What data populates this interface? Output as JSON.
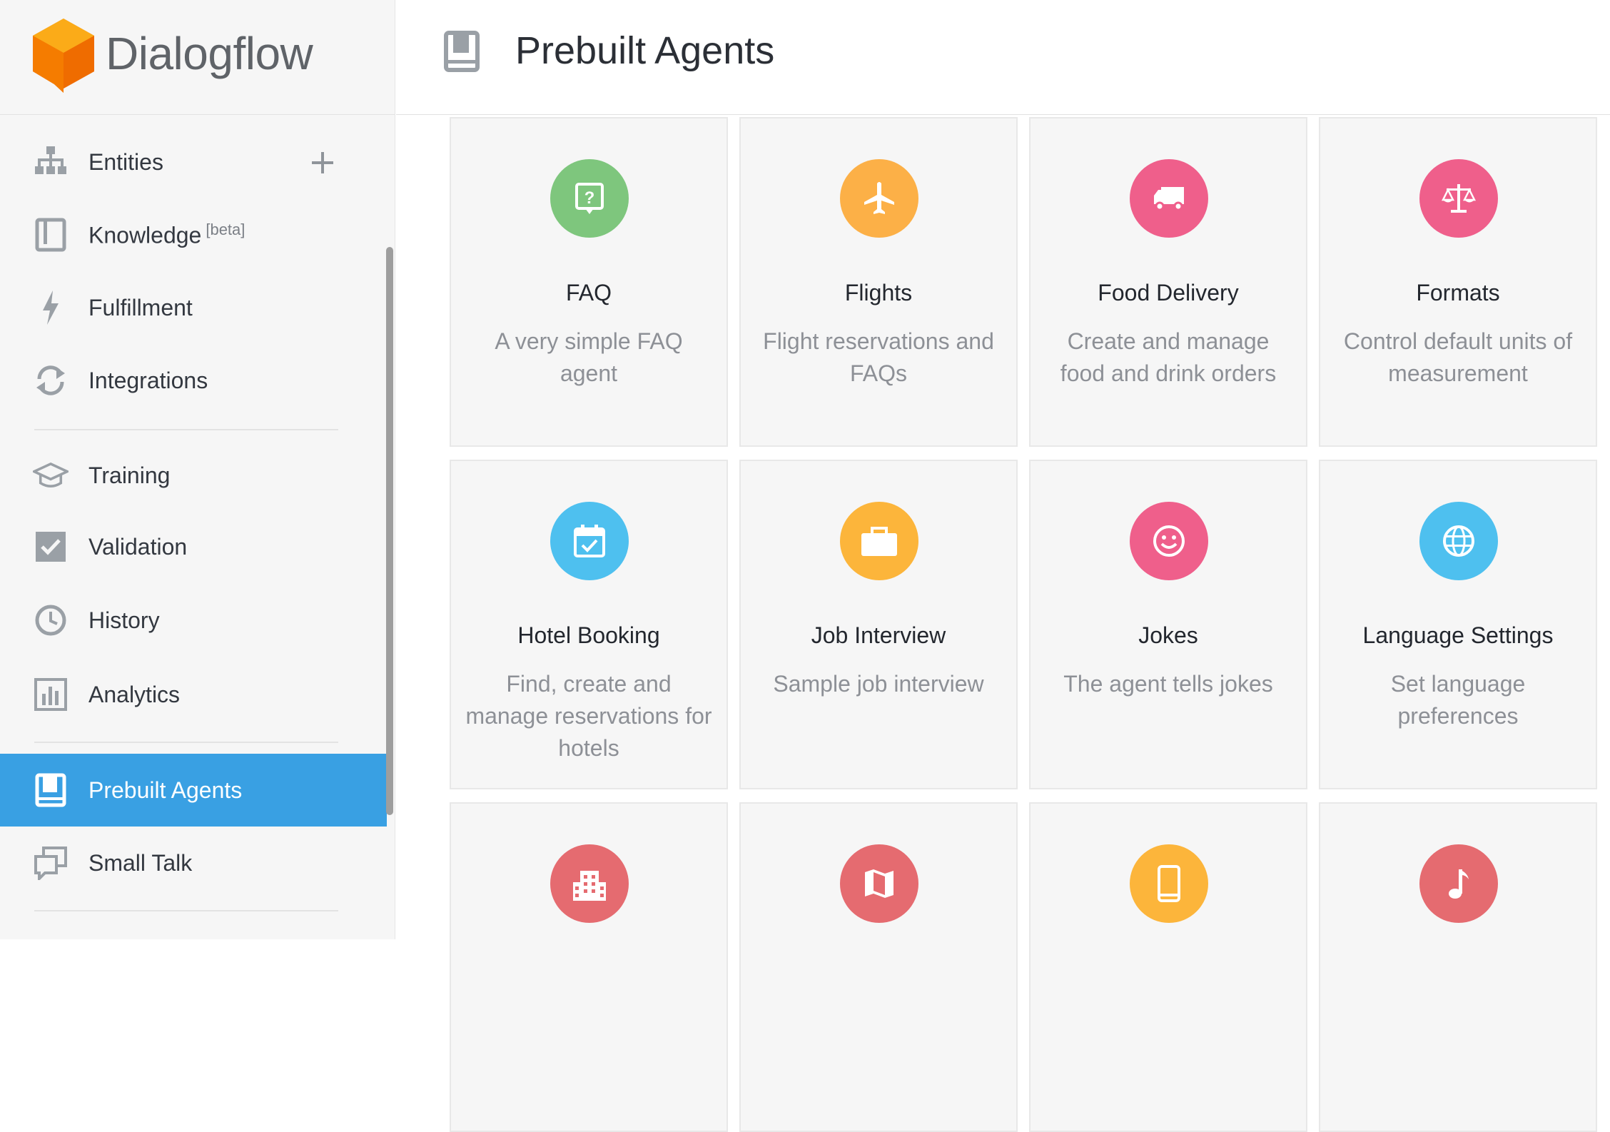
{
  "app": {
    "name": "Dialogflow"
  },
  "header": {
    "title": "Prebuilt Agents"
  },
  "sidebar": {
    "items": [
      {
        "label": "Entities",
        "icon": "entities-icon"
      },
      {
        "label": "Knowledge",
        "badge": "[beta]",
        "icon": "knowledge-icon"
      },
      {
        "label": "Fulfillment",
        "icon": "fulfillment-icon"
      },
      {
        "label": "Integrations",
        "icon": "integrations-icon"
      },
      {
        "label": "Training",
        "icon": "training-icon"
      },
      {
        "label": "Validation",
        "icon": "validation-icon"
      },
      {
        "label": "History",
        "icon": "history-icon"
      },
      {
        "label": "Analytics",
        "icon": "analytics-icon"
      },
      {
        "label": "Prebuilt Agents",
        "icon": "prebuilt-agents-icon",
        "active": true
      },
      {
        "label": "Small Talk",
        "icon": "small-talk-icon"
      }
    ],
    "active_color": "#39a0e3"
  },
  "agents": [
    {
      "title": "FAQ",
      "desc": "A very simple FAQ agent",
      "icon": "faq-icon",
      "color": "#7ec67d"
    },
    {
      "title": "Flights",
      "desc": "Flight reservations and FAQs",
      "icon": "airplane-icon",
      "color": "#fcb047"
    },
    {
      "title": "Food Delivery",
      "desc": "Create and manage food and drink orders",
      "icon": "truck-icon",
      "color": "#ef5f8b"
    },
    {
      "title": "Formats",
      "desc": "Control default units of measurement",
      "icon": "scale-icon",
      "color": "#ef5f8b"
    },
    {
      "title": "Hotel Booking",
      "desc": "Find, create and manage reservations for hotels",
      "icon": "calendar-check-icon",
      "color": "#4ec0ef"
    },
    {
      "title": "Job Interview",
      "desc": "Sample job interview",
      "icon": "briefcase-icon",
      "color": "#fcb53b"
    },
    {
      "title": "Jokes",
      "desc": "The agent tells jokes",
      "icon": "smiley-icon",
      "color": "#ef5f8b"
    },
    {
      "title": "Language Settings",
      "desc": "Set language preferences",
      "icon": "globe-icon",
      "color": "#4ec0ef"
    },
    {
      "title": "",
      "desc": "",
      "icon": "building-icon",
      "color": "#e56b70"
    },
    {
      "title": "",
      "desc": "",
      "icon": "map-icon",
      "color": "#e56b70"
    },
    {
      "title": "",
      "desc": "",
      "icon": "phone-icon",
      "color": "#fcb53b"
    },
    {
      "title": "",
      "desc": "",
      "icon": "music-note-icon",
      "color": "#e56b70"
    }
  ]
}
